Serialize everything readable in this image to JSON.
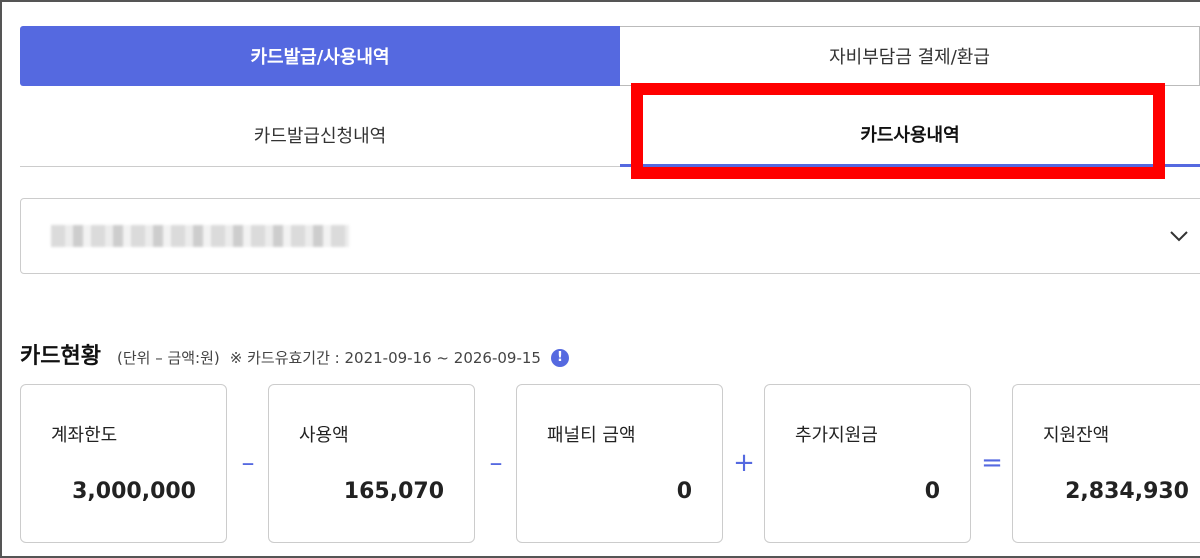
{
  "top_tabs": {
    "active_label": "카드발급/사용내역",
    "inactive_label": "자비부담금 결제/환급"
  },
  "sub_tabs": {
    "first_label": "카드발급신청내역",
    "second_label": "카드사용내역"
  },
  "card_select": {
    "selected_value": "",
    "chevron_icon": "chevron-down-icon"
  },
  "card_status": {
    "title": "카드현황",
    "unit_note": "(단위 – 금액:원)",
    "validity": "※ 카드유효기간 : 2021-09-16 ~ 2026-09-15",
    "info_icon": "!"
  },
  "summary": [
    {
      "label": "계좌한도",
      "value": "3,000,000"
    },
    {
      "label": "사용액",
      "value": "165,070"
    },
    {
      "label": "패널티 금액",
      "value": "0"
    },
    {
      "label": "추가지원금",
      "value": "0"
    },
    {
      "label": "지원잔액",
      "value": "2,834,930"
    }
  ],
  "operators": [
    "–",
    "–",
    "+",
    "="
  ],
  "colors": {
    "accent": "#5569e0",
    "highlight": "#ff0000"
  }
}
